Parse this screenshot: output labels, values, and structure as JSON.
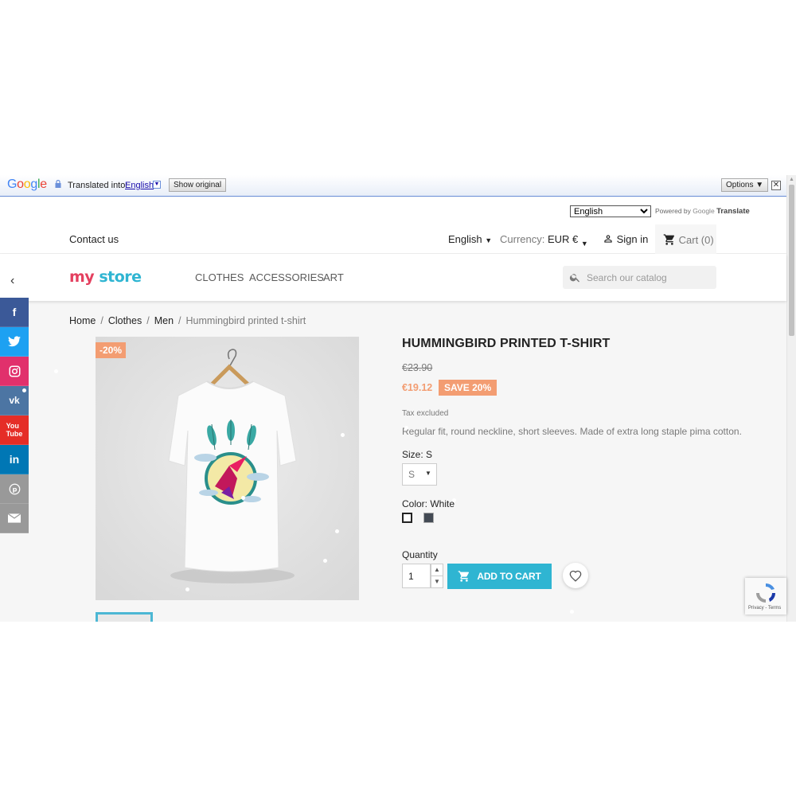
{
  "translate_bar": {
    "logo": "Google",
    "translated_into_label": "Translated into:",
    "language": "English",
    "show_original": "Show original",
    "options": "Options ▼"
  },
  "language_widget": {
    "selected": "English",
    "powered_by": "Powered by",
    "google": "Google",
    "translate": "Translate"
  },
  "nav": {
    "contact": "Contact us",
    "language": "English",
    "currency_label": "Currency:",
    "currency_value": "EUR €",
    "sign_in": "Sign in",
    "cart": "Cart (0)"
  },
  "header": {
    "logo": {
      "my": "my",
      "store": "store"
    },
    "menu": [
      "CLOTHES",
      "ACCESSORIES",
      "ART"
    ],
    "search_placeholder": "Search our catalog"
  },
  "social": [
    "facebook",
    "twitter",
    "instagram",
    "vk",
    "youtube",
    "linkedin",
    "pinterest",
    "email"
  ],
  "breadcrumb": [
    "Home",
    "Clothes",
    "Men",
    "Hummingbird printed t-shirt"
  ],
  "product": {
    "discount_flag": "-20%",
    "title": "HUMMINGBIRD PRINTED T-SHIRT",
    "old_price": "€23.90",
    "price": "€19.12",
    "save_badge": "SAVE 20%",
    "tax": "Tax excluded",
    "description": "Regular fit, round neckline, short sleeves. Made of extra long staple pima cotton.",
    "size_label": "Size: S",
    "size_value": "S",
    "color_label": "Color: White",
    "colors": [
      "#ffffff",
      "#434a54"
    ],
    "quantity_label": "Quantity",
    "quantity": "1",
    "add_to_cart": "ADD TO CART"
  },
  "recaptcha": {
    "terms": "Privacy - Terms"
  },
  "colors": {
    "accent": "#2fb5d2",
    "discount": "#f39d72"
  }
}
